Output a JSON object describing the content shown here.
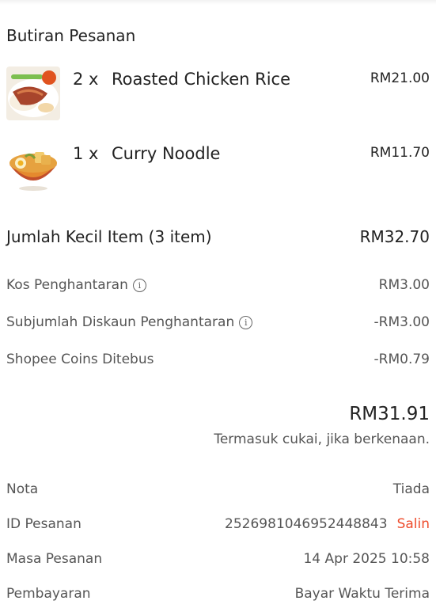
{
  "section_title": "Butiran Pesanan",
  "items": [
    {
      "qty": "2 x",
      "name": "Roasted Chicken Rice",
      "price": "RM21.00",
      "image": "roasted-chicken-rice-photo"
    },
    {
      "qty": "1 x",
      "name": "Curry Noodle",
      "price": "RM11.70",
      "image": "curry-noodle-photo"
    }
  ],
  "summary": {
    "subtotal_label": "Jumlah Kecil Item (3 item)",
    "subtotal_value": "RM32.70",
    "delivery_label": "Kos Penghantaran",
    "delivery_value": "RM3.00",
    "delivery_discount_label": "Subjumlah Diskaun Penghantaran",
    "delivery_discount_value": "-RM3.00",
    "coins_label": "Shopee Coins Ditebus",
    "coins_value": "-RM0.79",
    "info_icon_glyph": "i"
  },
  "total": {
    "amount": "RM31.91",
    "tax_note": "Termasuk cukai, jika berkenaan."
  },
  "details": {
    "note_label": "Nota",
    "note_value": "Tiada",
    "order_id_label": "ID Pesanan",
    "order_id_value": "2526981046952448843",
    "copy_label": "Salin",
    "order_time_label": "Masa Pesanan",
    "order_time_value": "14 Apr 2025 10:58",
    "payment_label": "Pembayaran",
    "payment_value": "Bayar Waktu Terima"
  },
  "colors": {
    "accent": "#ee4d2d",
    "text_primary": "#222222",
    "text_secondary": "#555555"
  }
}
